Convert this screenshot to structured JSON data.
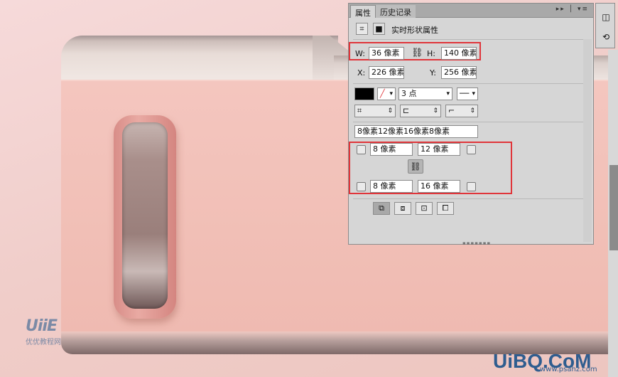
{
  "panel": {
    "tabs": [
      {
        "label": "属性"
      },
      {
        "label": "历史记录"
      }
    ],
    "menu_icon": "double-chevron-menu-icon",
    "title": "实时形状属性",
    "width_label": "W:",
    "width_value": "36 像素",
    "height_label": "H:",
    "height_value": "140 像素",
    "x_label": "X:",
    "x_value": "226 像素",
    "y_label": "Y:",
    "y_value": "256 像素",
    "stroke_width": "3 点",
    "corner_summary": "8像素12像素16像素8像素",
    "corners": {
      "top_left": "8 像素",
      "top_right": "12 像素",
      "bottom_left": "8 像素",
      "bottom_right": "16 像素"
    },
    "link_icon": "chain-link-icon"
  },
  "watermarks": {
    "left_logo": "UiiE",
    "left_caption": "优优教程网",
    "right_logo": "UiBQ.CoM",
    "right_caption": "www.psahz.com"
  },
  "colors": {
    "highlight": "#e0353a",
    "panel_bg": "#d6d6d6",
    "folder_pink": "#f1bfb6"
  }
}
